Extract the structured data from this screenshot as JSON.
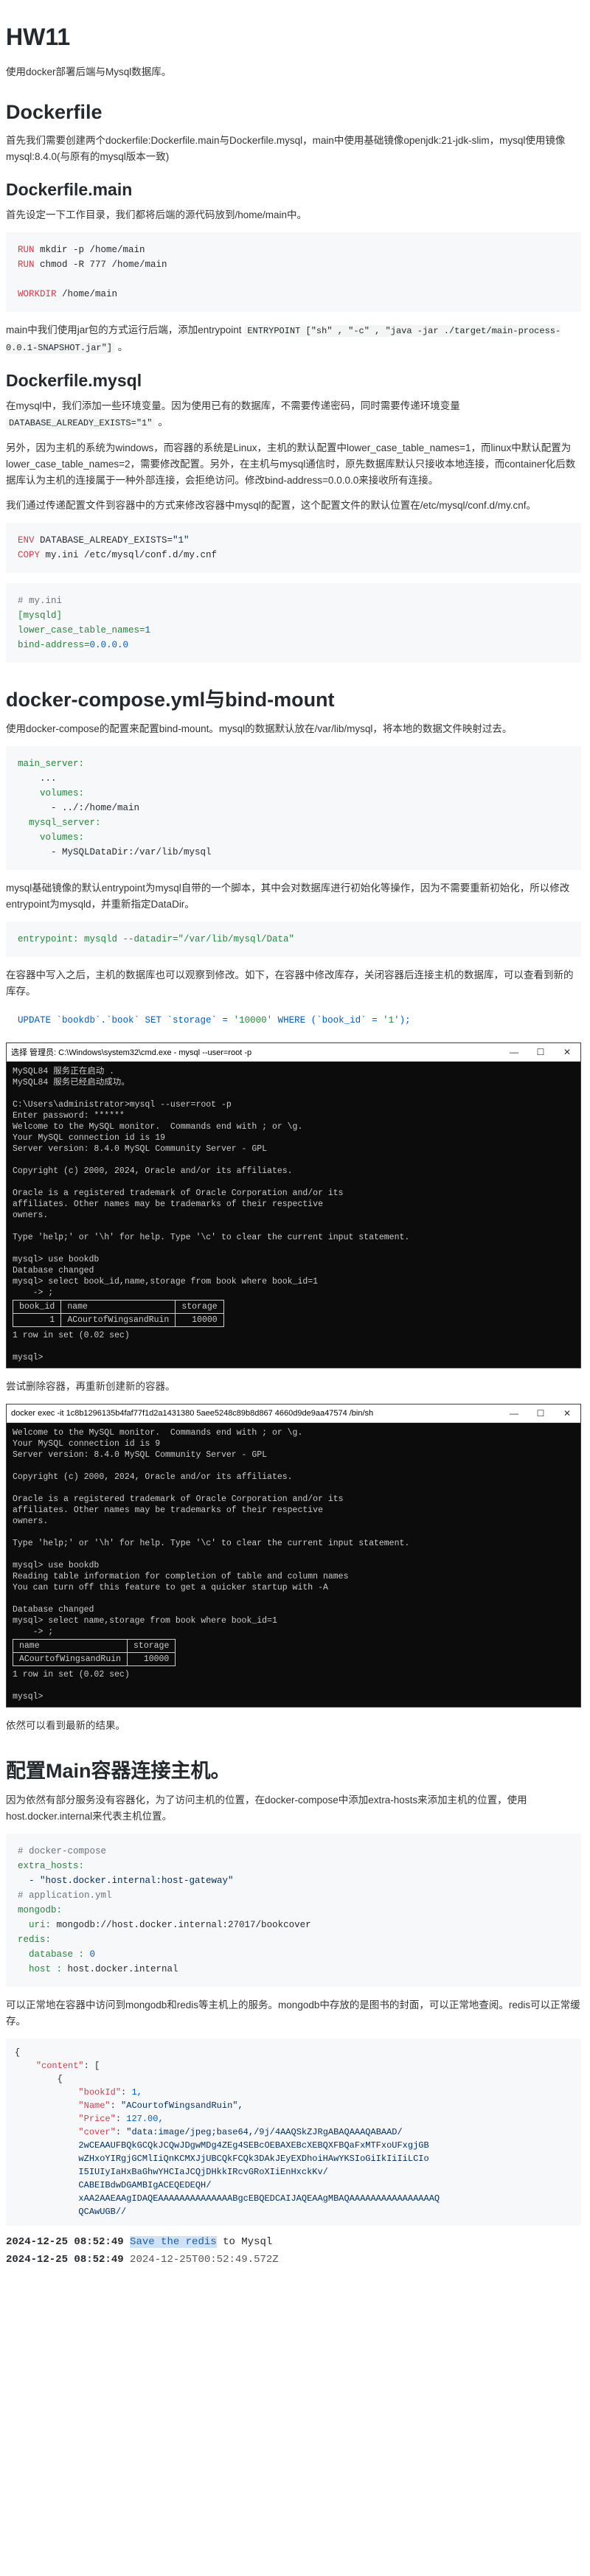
{
  "title": "HW11",
  "intro": "使用docker部署后端与Mysql数据库。",
  "sec_dockerfile": {
    "heading": "Dockerfile",
    "p": "首先我们需要创建两个dockerfile:Dockerfile.main与Dockerfile.mysql，main中使用基础镜像openjdk:21-jdk-slim，mysql使用镜像mysql:8.4.0(与原有的mysql版本一致)"
  },
  "sec_main": {
    "heading": "Dockerfile.main",
    "p1": "首先设定一下工作目录，我们都将后端的源代码放到/home/main中。",
    "code": [
      {
        "kw": "RUN",
        "rest": " mkdir -p /home/main"
      },
      {
        "kw": "RUN",
        "rest": " chmod -R 777 /home/main"
      },
      {
        "kw": "",
        "rest": ""
      },
      {
        "kw": "WORKDIR",
        "rest": " /home/main"
      }
    ],
    "p2_pre": "main中我们使用jar包的方式运行后端，添加entrypoint ",
    "p2_code": "ENTRYPOINT [\"sh\" , \"-c\" , \"java -jar ./target/main-process-0.0.1-SNAPSHOT.jar\"]",
    "p2_post": " 。"
  },
  "sec_mysql": {
    "heading": "Dockerfile.mysql",
    "p1_pre": "在mysql中，我们添加一些环境变量。因为使用已有的数据库，不需要传递密码，同时需要传递环境变量 ",
    "p1_code": "DATABASE_ALREADY_EXISTS=\"1\"",
    "p1_post": " 。",
    "p2": "另外，因为主机的系统为windows，而容器的系统是Linux，主机的默认配置中lower_case_table_names=1，而linux中默认配置为lower_case_table_names=2，需要修改配置。另外，在主机与mysql通信时，原先数据库默认只接收本地连接，而container化后数据库认为主机的连接属于一种外部连接，会拒绝访问。修改bind-address=0.0.0.0来接收所有连接。",
    "p3": "我们通过传递配置文件到容器中的方式来修改容器中mysql的配置，这个配置文件的默认位置在/etc/mysql/conf.d/my.cnf。",
    "code1": [
      {
        "kw": "ENV",
        "rest": " DATABASE_ALREADY_EXISTS=",
        "str": "\"1\""
      },
      {
        "kw": "COPY",
        "rest": " my.ini /etc/mysql/conf.d/my.cnf",
        "str": ""
      }
    ],
    "code2": [
      {
        "c": "cm",
        "t": "# my.ini"
      },
      {
        "c": "key",
        "t": "[mysqld]"
      },
      {
        "c": "key",
        "t": "lower_case_table_names=",
        "n": "1"
      },
      {
        "c": "key",
        "t": "bind-address=",
        "n": "0.0.0.0"
      }
    ]
  },
  "sec_compose": {
    "heading": "docker-compose.yml与bind-mount",
    "p1": "使用docker-compose的配置来配置bind-mount。mysql的数据默认放在/var/lib/mysql，将本地的数据文件映射过去。",
    "code": [
      "main_server:",
      "    ...",
      "    volumes:",
      "      - ../:/home/main",
      "  mysql_server:",
      "    volumes:",
      "      - MySQLDataDir:/var/lib/mysql"
    ],
    "p2": "mysql基础镜像的默认entrypoint为mysql自带的一个脚本，其中会对数据库进行初始化等操作，因为不需要重新初始化，所以修改entrypoint为mysqld，并重新指定DataDir。",
    "code2": "entrypoint: mysqld --datadir=\"/var/lib/mysql/Data\"",
    "p3": "在容器中写入之后，主机的数据库也可以观察到修改。如下，在容器中修改库存，关闭容器后连接主机的数据库，可以查看到新的库存。",
    "sql": {
      "a": "UPDATE `bookdb`.`book` SET `storage` = ",
      "b": "'10000'",
      "c": " WHERE (`book_id` = ",
      "d": "'1'",
      "e": ");"
    }
  },
  "terminal1": {
    "title": "选择 管理员: C:\\Windows\\system32\\cmd.exe - mysql --user=root -p",
    "lines": [
      "MySQL84 服务正在启动 .",
      "MySQL84 服务已经启动成功。",
      "",
      "C:\\Users\\administrator>mysql --user=root -p",
      "Enter password: ******",
      "Welcome to the MySQL monitor.  Commands end with ; or \\g.",
      "Your MySQL connection id is 19",
      "Server version: 8.4.0 MySQL Community Server - GPL",
      "",
      "Copyright (c) 2000, 2024, Oracle and/or its affiliates.",
      "",
      "Oracle is a registered trademark of Oracle Corporation and/or its",
      "affiliates. Other names may be trademarks of their respective",
      "owners.",
      "",
      "Type 'help;' or '\\h' for help. Type '\\c' to clear the current input statement.",
      "",
      "mysql> use bookdb",
      "Database changed",
      "mysql> select book_id,name,storage from book where book_id=1",
      "    -> ;"
    ],
    "table_head": [
      "book_id",
      "name",
      "storage"
    ],
    "table_row": [
      "1",
      "ACourtofWingsandRuin",
      "10000"
    ],
    "after": [
      "1 row in set (0.02 sec)",
      "",
      "mysql>"
    ]
  },
  "p_retry": "尝试删除容器，再重新创建新的容器。",
  "terminal2": {
    "title": "docker exec -it 1c8b1296135b4faf77f1d2a1431380 5aee5248c89b8d867 4660d9de9aa47574 /bin/sh",
    "lines": [
      "Welcome to the MySQL monitor.  Commands end with ; or \\g.",
      "Your MySQL connection id is 9",
      "Server version: 8.4.0 MySQL Community Server - GPL",
      "",
      "Copyright (c) 2000, 2024, Oracle and/or its affiliates.",
      "",
      "Oracle is a registered trademark of Oracle Corporation and/or its",
      "affiliates. Other names may be trademarks of their respective",
      "owners.",
      "",
      "Type 'help;' or '\\h' for help. Type '\\c' to clear the current input statement.",
      "",
      "mysql> use bookdb",
      "Reading table information for completion of table and column names",
      "You can turn off this feature to get a quicker startup with -A",
      "",
      "Database changed",
      "mysql> select name,storage from book where book_id=1",
      "    -> ;"
    ],
    "table_head": [
      "name",
      "storage"
    ],
    "table_row": [
      "ACourtofWingsandRuin",
      "10000"
    ],
    "after": [
      "1 row in set (0.02 sec)",
      "",
      "mysql> "
    ]
  },
  "p_result": "依然可以看到最新的结果。",
  "sec_host": {
    "heading": "配置Main容器连接主机。",
    "p1": "因为依然有部分服务没有容器化，为了访问主机的位置，在docker-compose中添加extra-hosts来添加主机的位置，使用host.docker.internal来代表主机位置。",
    "code": [
      {
        "c": "cm",
        "k": "# docker-compose",
        "v": ""
      },
      {
        "c": "key",
        "k": "extra_hosts:",
        "v": ""
      },
      {
        "c": "str",
        "k": "  - \"host.docker.internal:host-gateway\"",
        "v": ""
      },
      {
        "c": "cm",
        "k": "# application.yml",
        "v": ""
      },
      {
        "c": "key",
        "k": "mongodb:",
        "v": ""
      },
      {
        "c": "key",
        "k": "  uri:",
        "v": " mongodb://host.docker.internal:27017/bookcover"
      },
      {
        "c": "key",
        "k": "redis:",
        "v": ""
      },
      {
        "c": "key",
        "k": "  database :",
        "n": " 0"
      },
      {
        "c": "key",
        "k": "  host :",
        "v": " host.docker.internal"
      }
    ],
    "p2": "可以正常地在容器中访问到mongodb和redis等主机上的服务。mongodb中存放的是图书的封面，可以正常地查阅。redis可以正常缓存。"
  },
  "json_block": {
    "lines": [
      "{",
      "    \"content\": [",
      "        {",
      "            \"bookId\": 1,",
      "            \"Name\": \"ACourtofWingsandRuin\",",
      "            \"Price\": 127.00,",
      "            \"cover\": \"data:image/jpeg;base64,/9j/4AAQSkZJRgABAQAAAQABAAD/",
      "            2wCEAAUFBQkGCQkJCQwJDgwMDg4ZEg4SEBcOEBAXEBcXEBQXFBQaFxMTFxoUFxgjGB",
      "            wZHxoYIRgjGCMlIiQnKCMXJjUBCQkFCQk3DAkJEyEXDhoiHAwYKSIoGiIkIiIiLCIo",
      "            I5IUIyIaHxBaGhwYHCIaJCQjDHkkIRcvGRoXIiEnHxckKv/",
      "            CABEIBdwDGAMBIgACEQEDEQH/",
      "            xAA2AAEAAgIDAQEAAAAAAAAAAAAAABgcEBQEDCAIJAQEAAgMBAQAAAAAAAAAAAAAAAAQ",
      "            QCAwUGB//"
    ]
  },
  "log": [
    {
      "ts": "2024-12-25 08:52:49",
      "hl": "Save the redis",
      "rest": " to Mysql"
    },
    {
      "ts": "2024-12-25 08:52:49",
      "hl": "",
      "rest": "2024-12-25T00:52:49.572Z"
    }
  ]
}
